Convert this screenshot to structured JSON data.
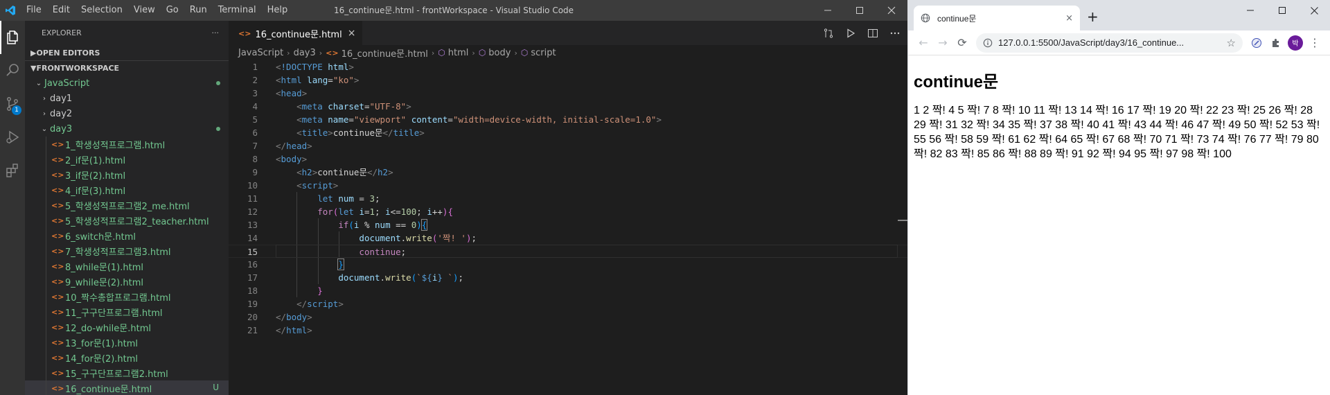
{
  "vscode": {
    "menu": [
      "File",
      "Edit",
      "Selection",
      "View",
      "Go",
      "Run",
      "Terminal",
      "Help"
    ],
    "window_title": "16_continue문.html - frontWorkspace - Visual Studio Code",
    "scm_badge": "1",
    "explorer_title": "EXPLORER",
    "explorer_more": "···",
    "open_editors": "OPEN EDITORS",
    "workspace": "FRONTWORKSPACE",
    "tree": {
      "root": "JavaScript",
      "folders": [
        "day1",
        "day2"
      ],
      "open_folder": "day3",
      "files": [
        "1_학생성적프로그램.html",
        "2_if문(1).html",
        "3_if문(2).html",
        "4_if문(3).html",
        "5_학생성적프로그램2_me.html",
        "5_학생성적프로그램2_teacher.html",
        "6_switch문.html",
        "7_학생성적프로그램3.html",
        "8_while문(1).html",
        "9_while문(2).html",
        "10_짝수총합프로그램.html",
        "11_구구단프로그램.html",
        "12_do-while문.html",
        "13_for문(1).html",
        "14_for문(2).html",
        "15_구구단프로그램2.html",
        "16_continue문.html"
      ],
      "untracked_badge": "U"
    },
    "tab": {
      "icon": "<>",
      "label": "16_continue문.html",
      "close": "×"
    },
    "breadcrumb": [
      "JavaScript",
      "day3",
      "16_continue문.html",
      "html",
      "body",
      "script"
    ],
    "line_numbers": [
      "1",
      "2",
      "3",
      "4",
      "5",
      "6",
      "7",
      "8",
      "9",
      "10",
      "11",
      "12",
      "13",
      "14",
      "15",
      "16",
      "17",
      "18",
      "19",
      "20",
      "21"
    ]
  },
  "browser": {
    "tab_title": "continue문",
    "tab_close": "×",
    "new_tab": "+",
    "url": "127.0.0.1:5500/JavaScript/day3/16_continue...",
    "avatar_initial": "박",
    "page_heading": "continue문",
    "page_output": "1 2 짝! 4 5 짝! 7 8 짝! 10 11 짝! 13 14 짝! 16 17 짝! 19 20 짝! 22 23 짝! 25 26 짝! 28 29 짝! 31 32 짝! 34 35 짝! 37 38 짝! 40 41 짝! 43 44 짝! 46 47 짝! 49 50 짝! 52 53 짝! 55 56 짝! 58 59 짝! 61 62 짝! 64 65 짝! 67 68 짝! 70 71 짝! 73 74 짝! 76 77 짝! 79 80 짝! 82 83 짝! 85 86 짝! 88 89 짝! 91 92 짝! 94 95 짝! 97 98 짝! 100"
  },
  "code_lines": [
    [
      [
        "t-brk",
        "<"
      ],
      [
        "t-tag",
        "!DOCTYPE"
      ],
      [
        "t-txt",
        " "
      ],
      [
        "t-attr",
        "html"
      ],
      [
        "t-brk",
        ">"
      ]
    ],
    [
      [
        "t-brk",
        "<"
      ],
      [
        "t-tag",
        "html"
      ],
      [
        "t-txt",
        " "
      ],
      [
        "t-attr",
        "lang"
      ],
      [
        "t-txt",
        "="
      ],
      [
        "t-str",
        "\"ko\""
      ],
      [
        "t-brk",
        ">"
      ]
    ],
    [
      [
        "t-brk",
        "<"
      ],
      [
        "t-tag",
        "head"
      ],
      [
        "t-brk",
        ">"
      ]
    ],
    [
      [
        "t-txt",
        "    "
      ],
      [
        "t-brk",
        "<"
      ],
      [
        "t-tag",
        "meta"
      ],
      [
        "t-txt",
        " "
      ],
      [
        "t-attr",
        "charset"
      ],
      [
        "t-txt",
        "="
      ],
      [
        "t-str",
        "\"UTF-8\""
      ],
      [
        "t-brk",
        ">"
      ]
    ],
    [
      [
        "t-txt",
        "    "
      ],
      [
        "t-brk",
        "<"
      ],
      [
        "t-tag",
        "meta"
      ],
      [
        "t-txt",
        " "
      ],
      [
        "t-attr",
        "name"
      ],
      [
        "t-txt",
        "="
      ],
      [
        "t-str",
        "\"viewport\""
      ],
      [
        "t-txt",
        " "
      ],
      [
        "t-attr",
        "content"
      ],
      [
        "t-txt",
        "="
      ],
      [
        "t-str",
        "\"width=device-width, initial-scale=1.0\""
      ],
      [
        "t-brk",
        ">"
      ]
    ],
    [
      [
        "t-txt",
        "    "
      ],
      [
        "t-brk",
        "<"
      ],
      [
        "t-tag",
        "title"
      ],
      [
        "t-brk",
        ">"
      ],
      [
        "t-txt",
        "continue문"
      ],
      [
        "t-brk",
        "</"
      ],
      [
        "t-tag",
        "title"
      ],
      [
        "t-brk",
        ">"
      ]
    ],
    [
      [
        "t-brk",
        "</"
      ],
      [
        "t-tag",
        "head"
      ],
      [
        "t-brk",
        ">"
      ]
    ],
    [
      [
        "t-brk",
        "<"
      ],
      [
        "t-tag",
        "body"
      ],
      [
        "t-brk",
        ">"
      ]
    ],
    [
      [
        "t-txt",
        "    "
      ],
      [
        "t-brk",
        "<"
      ],
      [
        "t-tag",
        "h2"
      ],
      [
        "t-brk",
        ">"
      ],
      [
        "t-txt",
        "continue문"
      ],
      [
        "t-brk",
        "</"
      ],
      [
        "t-tag",
        "h2"
      ],
      [
        "t-brk",
        ">"
      ]
    ],
    [
      [
        "t-txt",
        "    "
      ],
      [
        "t-brk",
        "<"
      ],
      [
        "t-tag",
        "script"
      ],
      [
        "t-brk",
        ">"
      ]
    ],
    [
      [
        "t-txt",
        "        "
      ],
      [
        "t-dec",
        "let"
      ],
      [
        "t-txt",
        " "
      ],
      [
        "t-var",
        "num"
      ],
      [
        "t-op",
        " = "
      ],
      [
        "t-num",
        "3"
      ],
      [
        "t-op",
        ";"
      ]
    ],
    [
      [
        "t-txt",
        "        "
      ],
      [
        "t-kw",
        "for"
      ],
      [
        "t-brace",
        "("
      ],
      [
        "t-dec",
        "let"
      ],
      [
        "t-txt",
        " "
      ],
      [
        "t-var",
        "i"
      ],
      [
        "t-op",
        "="
      ],
      [
        "t-num",
        "1"
      ],
      [
        "t-op",
        "; "
      ],
      [
        "t-var",
        "i"
      ],
      [
        "t-op",
        "<="
      ],
      [
        "t-num",
        "100"
      ],
      [
        "t-op",
        "; "
      ],
      [
        "t-var",
        "i"
      ],
      [
        "t-op",
        "++"
      ],
      [
        "t-brace",
        ")"
      ],
      [
        "t-brace",
        "{"
      ]
    ],
    [
      [
        "t-txt",
        "            "
      ],
      [
        "t-kw",
        "if"
      ],
      [
        "t-pbrace",
        "("
      ],
      [
        "t-var",
        "i"
      ],
      [
        "t-op",
        " % "
      ],
      [
        "t-var",
        "num"
      ],
      [
        "t-op",
        " == "
      ],
      [
        "t-num",
        "0"
      ],
      [
        "t-pbrace",
        ")"
      ],
      [
        "t-pbrace t-match",
        "{"
      ]
    ],
    [
      [
        "t-txt",
        "                "
      ],
      [
        "t-var",
        "document"
      ],
      [
        "t-op",
        "."
      ],
      [
        "t-fn",
        "write"
      ],
      [
        "t-brace",
        "("
      ],
      [
        "t-str",
        "'짝! '"
      ],
      [
        "t-brace",
        ")"
      ],
      [
        "t-op",
        ";"
      ]
    ],
    [
      [
        "t-txt",
        "                "
      ],
      [
        "t-kw",
        "continue"
      ],
      [
        "t-op",
        ";"
      ]
    ],
    [
      [
        "t-txt",
        "            "
      ],
      [
        "t-pbrace t-match",
        "}"
      ]
    ],
    [
      [
        "t-txt",
        "            "
      ],
      [
        "t-var",
        "document"
      ],
      [
        "t-op",
        "."
      ],
      [
        "t-fn",
        "write"
      ],
      [
        "t-pbrace",
        "("
      ],
      [
        "t-str",
        "`"
      ],
      [
        "t-dec",
        "${"
      ],
      [
        "t-var",
        "i"
      ],
      [
        "t-dec",
        "}"
      ],
      [
        "t-str",
        " `"
      ],
      [
        "t-pbrace",
        ")"
      ],
      [
        "t-op",
        ";"
      ]
    ],
    [
      [
        "t-txt",
        "        "
      ],
      [
        "t-brace",
        "}"
      ]
    ],
    [
      [
        "t-txt",
        "    "
      ],
      [
        "t-brk",
        "</"
      ],
      [
        "t-tag",
        "script"
      ],
      [
        "t-brk",
        ">"
      ]
    ],
    [
      [
        "t-brk",
        "</"
      ],
      [
        "t-tag",
        "body"
      ],
      [
        "t-brk",
        ">"
      ]
    ],
    [
      [
        "t-brk",
        "</"
      ],
      [
        "t-tag",
        "html"
      ],
      [
        "t-brk",
        ">"
      ]
    ]
  ],
  "colors": {
    "accent": "#007acc",
    "untracked": "#73c991",
    "file_icon": "#e37933"
  }
}
